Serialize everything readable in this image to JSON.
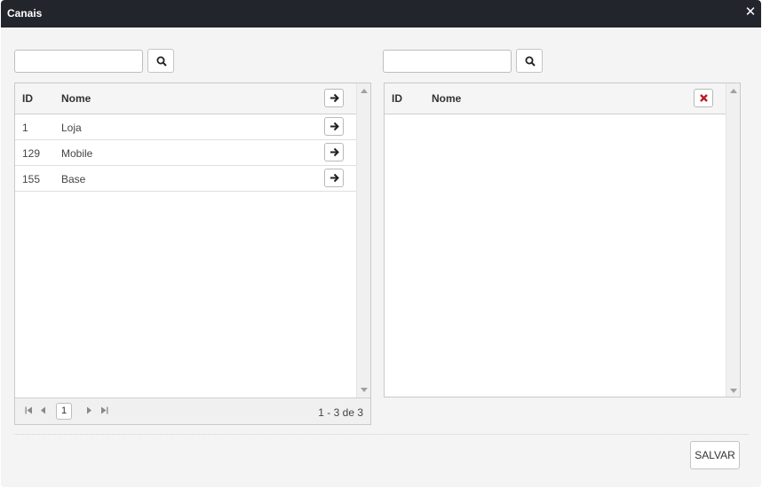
{
  "dialog": {
    "title": "Canais",
    "close_icon": "close-icon"
  },
  "left_panel": {
    "search_value": "",
    "columns": {
      "id": "ID",
      "nome": "Nome"
    },
    "rows": [
      {
        "id": "1",
        "nome": "Loja"
      },
      {
        "id": "129",
        "nome": "Mobile"
      },
      {
        "id": "155",
        "nome": "Base"
      }
    ],
    "pager": {
      "current_page": "1",
      "info": "1 - 3 de 3"
    }
  },
  "right_panel": {
    "search_value": "",
    "columns": {
      "id": "ID",
      "nome": "Nome"
    },
    "rows": []
  },
  "footer": {
    "save_label": "SALVAR"
  },
  "colors": {
    "titlebar": "#22252b",
    "remove_icon": "#c0171e",
    "background": "#f4f4f4"
  }
}
